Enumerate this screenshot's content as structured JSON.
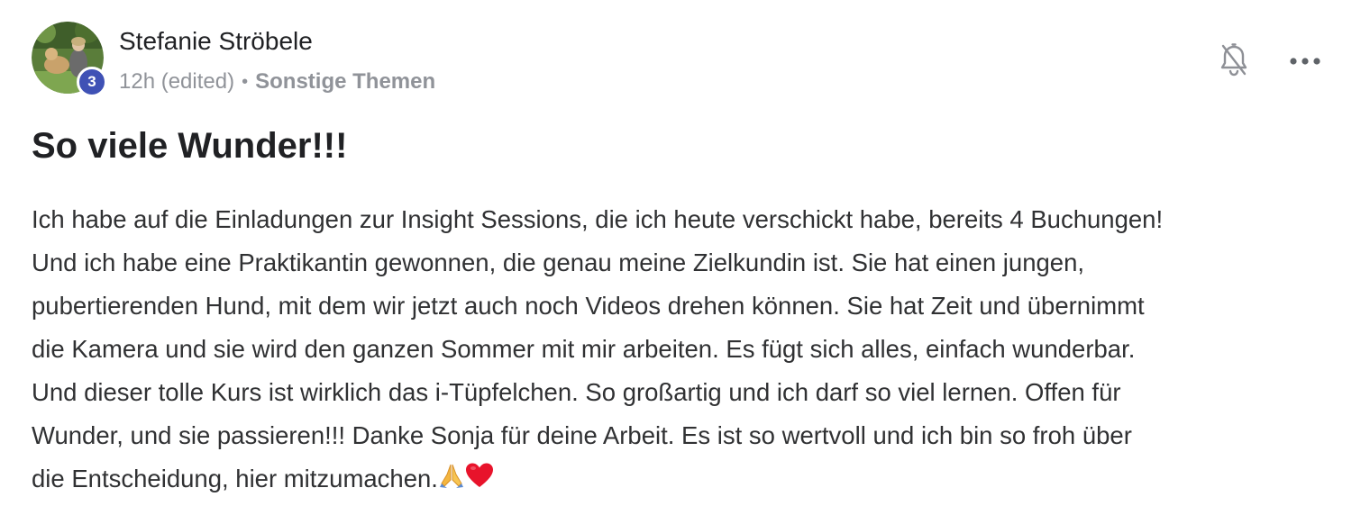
{
  "post": {
    "author": "Stefanie Ströbele",
    "level": "3",
    "time": "12h (edited)",
    "separator": "•",
    "category": "Sonstige Themen",
    "title": "So viele Wunder!!!",
    "body_lines": [
      "Ich habe auf die Einladungen zur Insight Sessions, die ich heute verschickt habe, bereits 4 Buchungen!",
      "Und ich habe eine Praktikantin gewonnen, die genau meine Zielkundin ist. Sie hat einen jungen,",
      "pubertierenden Hund, mit dem wir jetzt auch noch Videos drehen können. Sie hat Zeit und übernimmt",
      "die Kamera und sie wird den ganzen Sommer mit mir arbeiten. Es fügt sich alles, einfach wunderbar.",
      "Und dieser tolle Kurs ist wirklich das i-Tüpfelchen. So großartig und ich darf so viel lernen. Offen für",
      "Wunder, und sie passieren!!! Danke Sonja für deine Arbeit. Es ist so wertvoll und ich bin so froh über",
      "die Entscheidung, hier mitzumachen."
    ],
    "trailing_emoji": [
      "folded-hands-emoji",
      "red-heart-emoji"
    ]
  },
  "icons": {
    "notifications": "bell-off-icon",
    "more": "more-options-icon"
  },
  "colors": {
    "badge": "#3f51b5",
    "meta": "#909399",
    "text": "#303133"
  }
}
